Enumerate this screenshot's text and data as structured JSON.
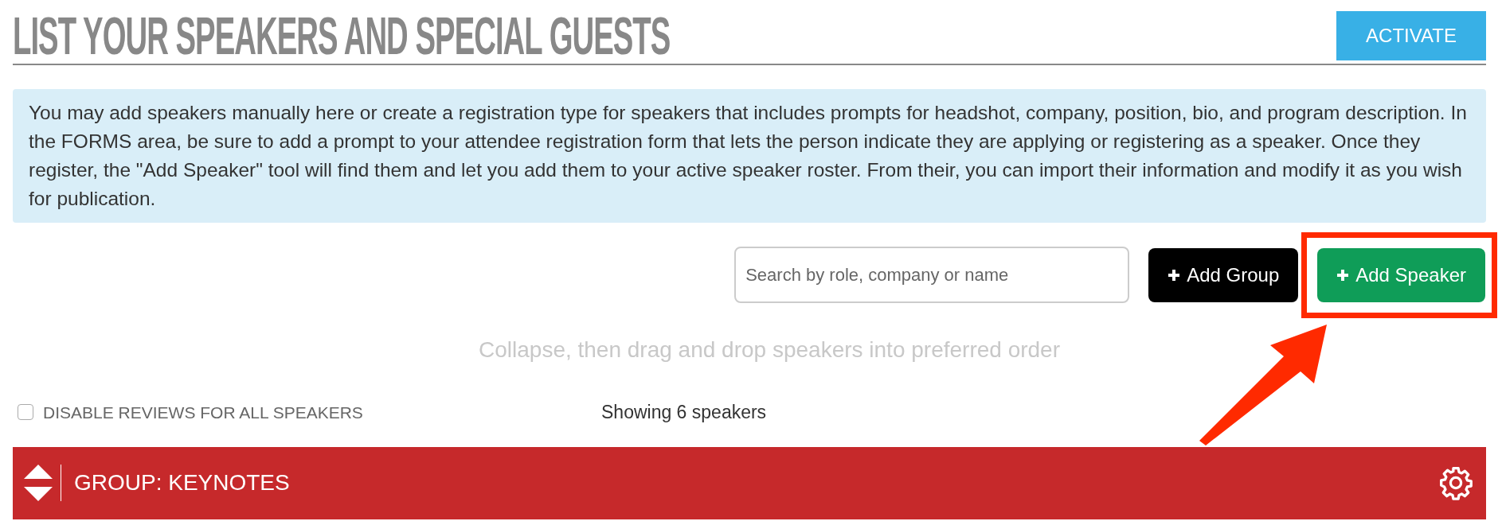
{
  "header": {
    "title": "LIST YOUR SPEAKERS AND SPECIAL GUESTS",
    "activate_button": "ACTIVATE"
  },
  "info": "You may add speakers manually here or create a registration type for speakers that includes prompts for headshot, company, position, bio, and program description. In the FORMS area, be sure to add a prompt to your attendee registration form that lets the person indicate they are applying or registering as a speaker. Once they register, the \"Add Speaker\" tool will find them and let you add them to your active speaker roster. From their, you can import their information and modify it as you wish for publication.",
  "search": {
    "placeholder": "Search by role, company or name"
  },
  "buttons": [
    {
      "label": "Add Group",
      "kind": "dark",
      "highlighted": false
    },
    {
      "label": "Add Speaker",
      "kind": "green",
      "highlighted": true
    }
  ],
  "hint": "Collapse, then drag and drop speakers into preferred order",
  "disable_reviews": {
    "label": "DISABLE REVIEWS FOR ALL SPEAKERS",
    "checked": false
  },
  "count": "Showing 6 speakers",
  "group": {
    "title": "GROUP: KEYNOTES"
  }
}
